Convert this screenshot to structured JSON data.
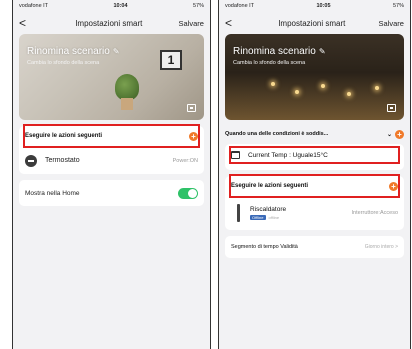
{
  "left": {
    "status": {
      "carrier": "vodafone IT",
      "time": "10:04",
      "battery": "57%"
    },
    "nav": {
      "back": "<",
      "title": "Impostazioni smart",
      "save": "Salvare"
    },
    "hero": {
      "name": "Rinomina scenario",
      "subtitle": "Cambia lo sfondo della scena",
      "clock": "1"
    },
    "actions": {
      "header": "Eseguire le azioni seguenti",
      "add": "+"
    },
    "device": {
      "name": "Termostato",
      "value": "Power:ON"
    },
    "home": {
      "label": "Mostra nella Home"
    }
  },
  "right": {
    "status": {
      "carrier": "vodafone IT",
      "time": "10:05",
      "battery": "57%"
    },
    "nav": {
      "back": "<",
      "title": "Impostazioni smart",
      "save": "Salvare"
    },
    "hero": {
      "name": "Rinomina scenario",
      "subtitle": "Cambia lo sfondo della scena"
    },
    "conditions": {
      "header": "Quando una delle condizioni è soddis...",
      "chevron": "⌄",
      "add": "+"
    },
    "condition": {
      "text": "Current Temp : Uguale15°C"
    },
    "actions": {
      "header": "Eseguire le azioni seguenti",
      "add": "+"
    },
    "device": {
      "name": "Riscaldatore",
      "badge": "Offline",
      "status": "offline",
      "action": "Interruttore:Acceso"
    },
    "validity": {
      "label": "Segmento di tempo Validità",
      "value": "Giorno intero >"
    }
  },
  "colors": {
    "accent_orange": "#f07a2a",
    "toggle_green": "#2fc268",
    "highlight_red": "#e02020"
  }
}
